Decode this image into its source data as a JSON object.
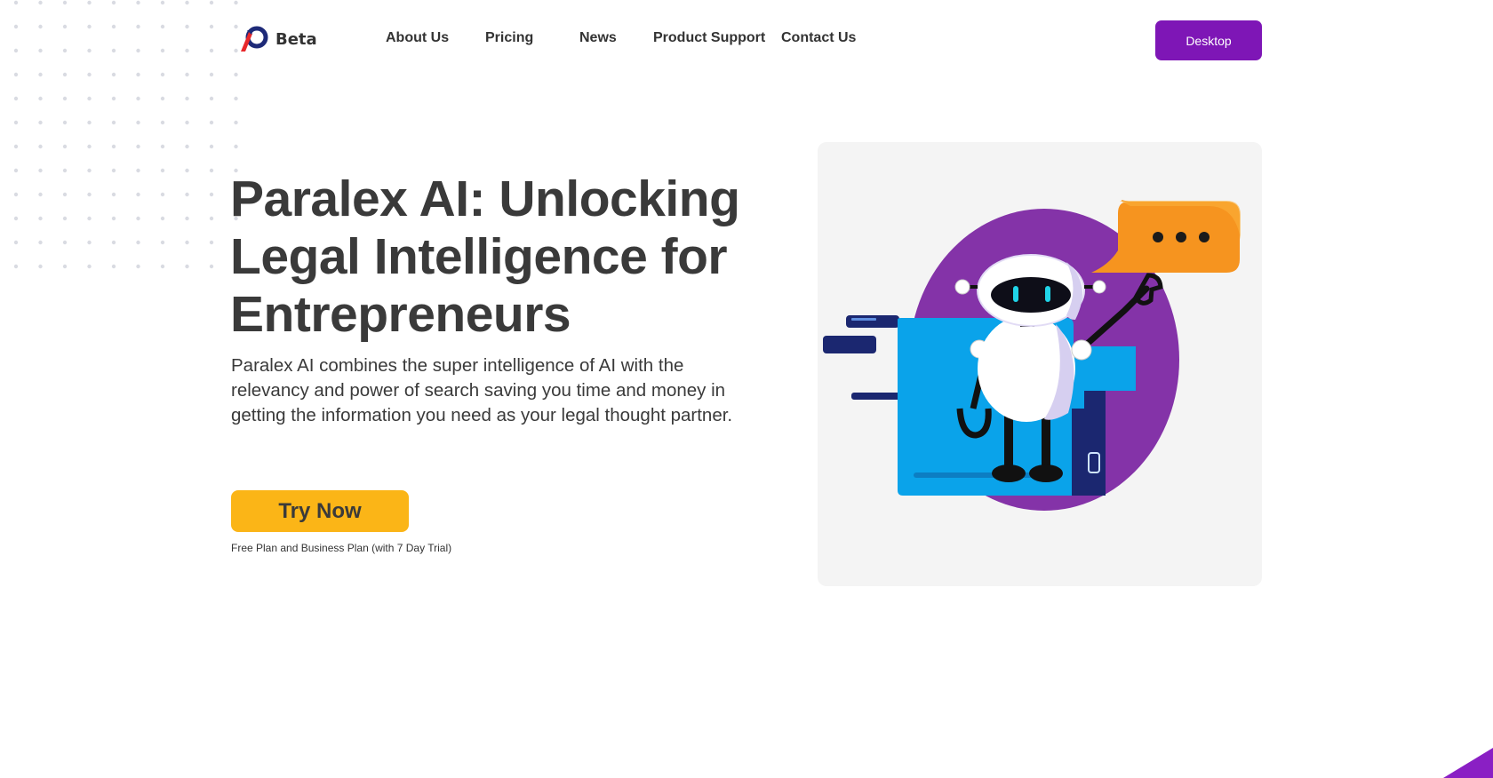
{
  "brand": {
    "name": "Beta",
    "logo_icon": "paralex-logo-icon",
    "colors": {
      "mark_blue": "#1e2a78",
      "mark_red": "#e8282b"
    }
  },
  "nav": {
    "links": [
      {
        "label": "About Us"
      },
      {
        "label": "Pricing"
      },
      {
        "label": "News"
      },
      {
        "label": "Product Support"
      },
      {
        "label": "Contact Us"
      }
    ],
    "cta_label": "Desktop"
  },
  "hero": {
    "title": "Paralex AI: Unlocking Legal Intelligence for Entrepreneurs",
    "subtitle": "Paralex AI combines the super intelligence of AI with the relevancy and power of search saving you time and money in getting the information you need as your legal thought partner.",
    "cta_label": "Try Now",
    "plan_note": "Free Plan and Business Plan (with 7 Day Trial)"
  },
  "illustration": {
    "icon": "robot-assistant-illustration",
    "chat_bubble_icon": "chat-bubble-icon"
  },
  "colors": {
    "accent_purple": "#7e16b6",
    "cta_yellow": "#fbb517",
    "text": "#3a3a3a",
    "card_bg": "#f4f4f4"
  }
}
